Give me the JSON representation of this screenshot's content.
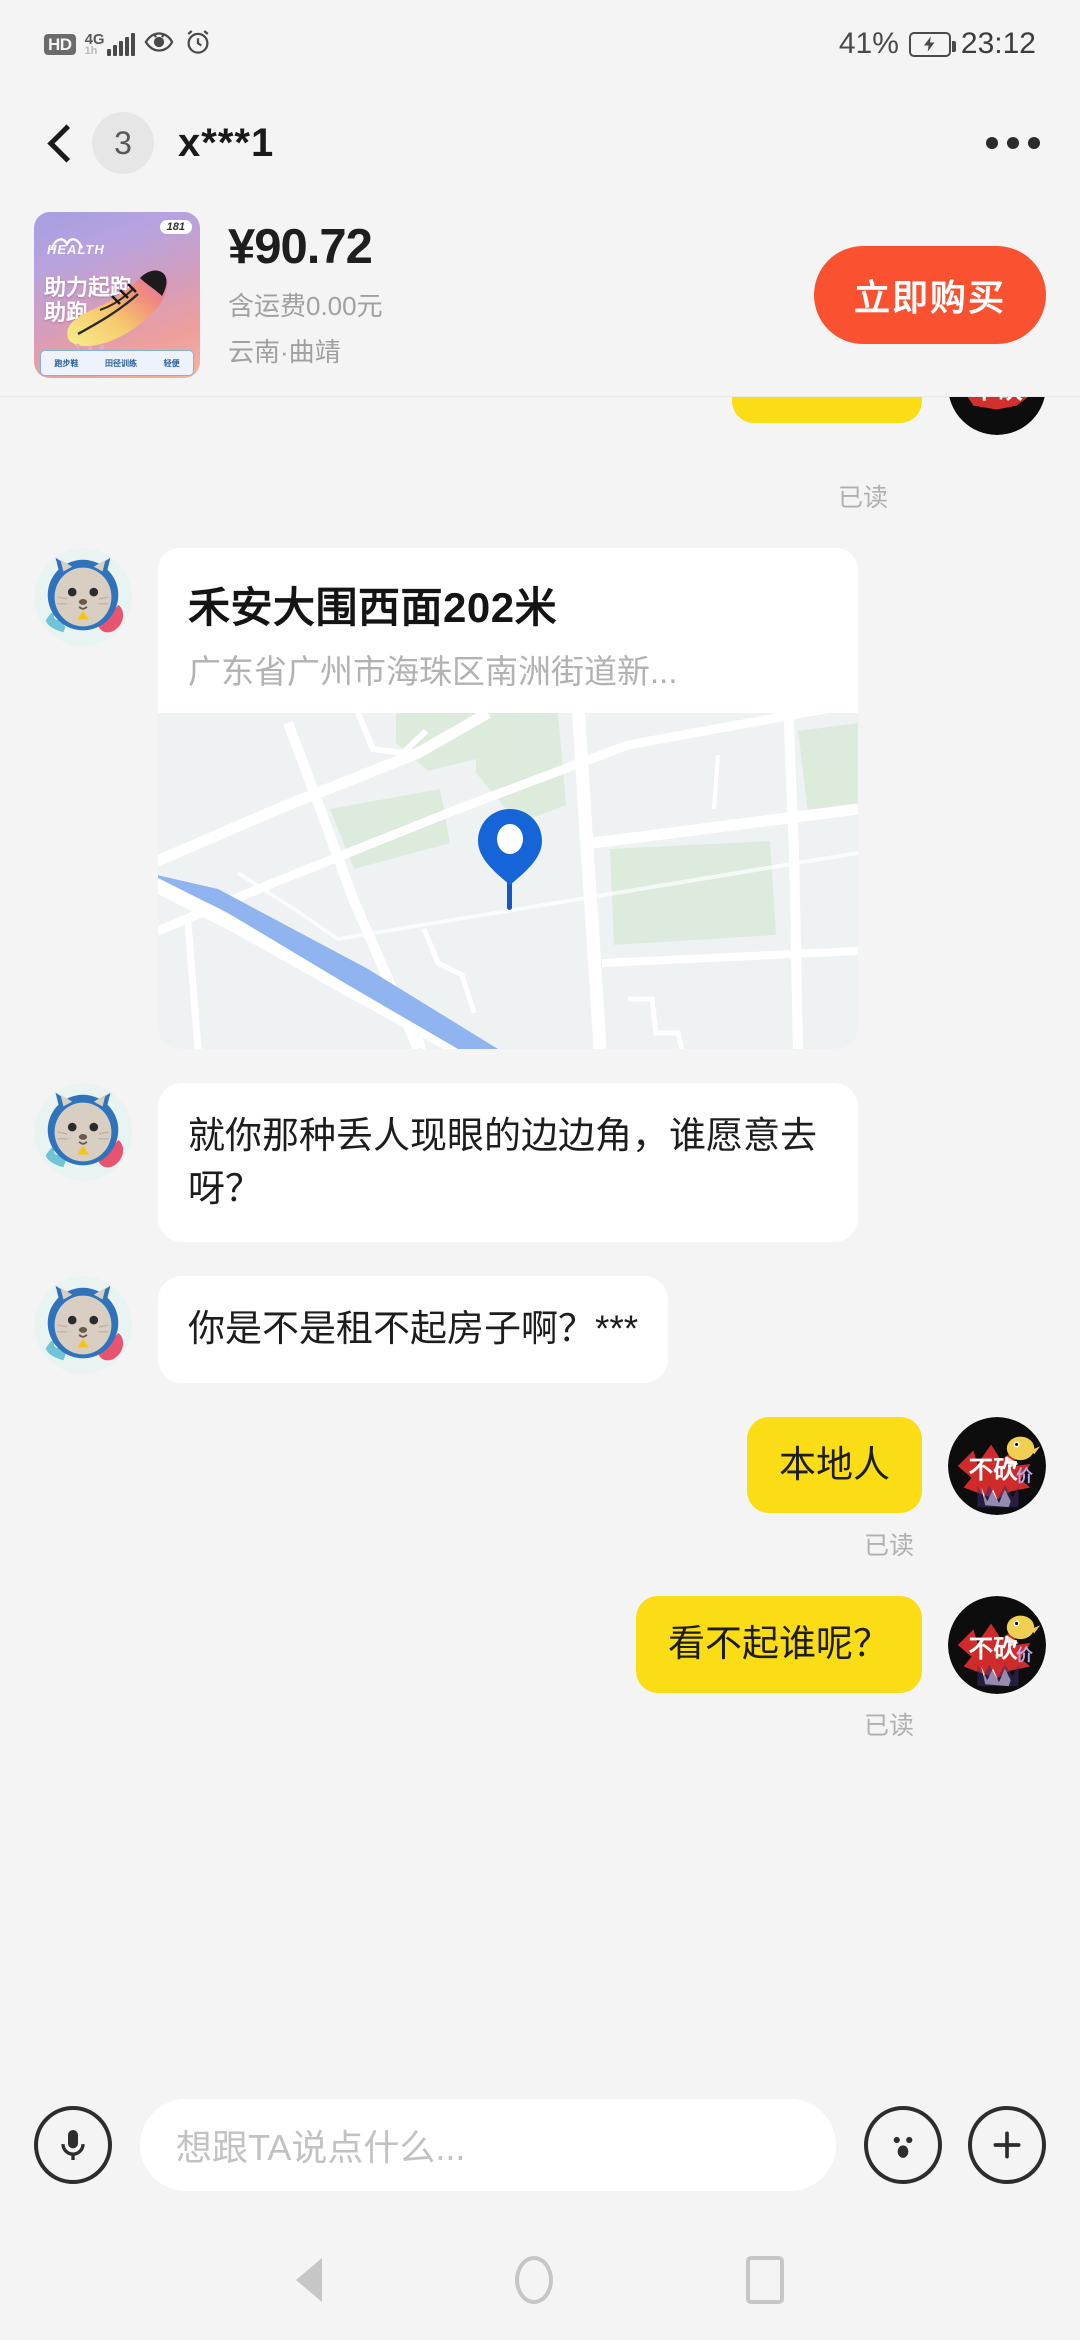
{
  "status_bar": {
    "hd_label": "HD",
    "network": "4G",
    "network_sub": "1h",
    "eye_icon": "eye-icon",
    "alarm_icon": "alarm-clock-icon",
    "battery_percent": "41%",
    "battery_state": "charging",
    "time": "23:12"
  },
  "header": {
    "back_icon": "back-chevron-icon",
    "unread_count": "3",
    "title": "x***1",
    "more_icon": "more-options-icon"
  },
  "product": {
    "price": "¥90.72",
    "shipping": "含运费0.00元",
    "location": "云南·曲靖",
    "buy_label": "立即购买",
    "thumb": {
      "brand": "HEALTH",
      "tag": "181",
      "slogan_line1": "助力起跑",
      "slogan_line2": "助跑",
      "footer_1": "跑步鞋",
      "footer_2": "田径训练",
      "footer_3": "轻便"
    }
  },
  "chat": {
    "read_label": "已读",
    "messages": [
      {
        "id": "m0",
        "side": "out",
        "type": "partial",
        "text": "",
        "read": "已读"
      },
      {
        "id": "m1",
        "side": "in",
        "type": "location",
        "title": "禾安大围西面202米",
        "address": "广东省广州市海珠区南洲街道新..."
      },
      {
        "id": "m2",
        "side": "in",
        "type": "text",
        "text": "就你那种丢人现眼的边边角，谁愿意去呀？"
      },
      {
        "id": "m3",
        "side": "in",
        "type": "text",
        "text": "你是不是租不起房子啊？***"
      },
      {
        "id": "m4",
        "side": "out",
        "type": "text",
        "text": "本地人",
        "read": "已读"
      },
      {
        "id": "m5",
        "side": "out",
        "type": "text",
        "text": "看不起谁呢？",
        "read": "已读"
      }
    ]
  },
  "input_bar": {
    "voice_icon": "microphone-icon",
    "placeholder": "想跟TA说点什么...",
    "emoji_icon": "emoji-face-icon",
    "plus_icon": "plus-icon"
  },
  "nav_bar": {
    "back": "nav-back-icon",
    "home": "nav-home-icon",
    "recents": "nav-recents-icon"
  },
  "colors": {
    "page_bg": "#f4f4f4",
    "buy_button": "#fa5131",
    "outgoing_bubble": "#fbdd16",
    "incoming_bubble": "#ffffff",
    "map_pin": "#1a73e8",
    "muted_text": "#b0b0b0"
  }
}
